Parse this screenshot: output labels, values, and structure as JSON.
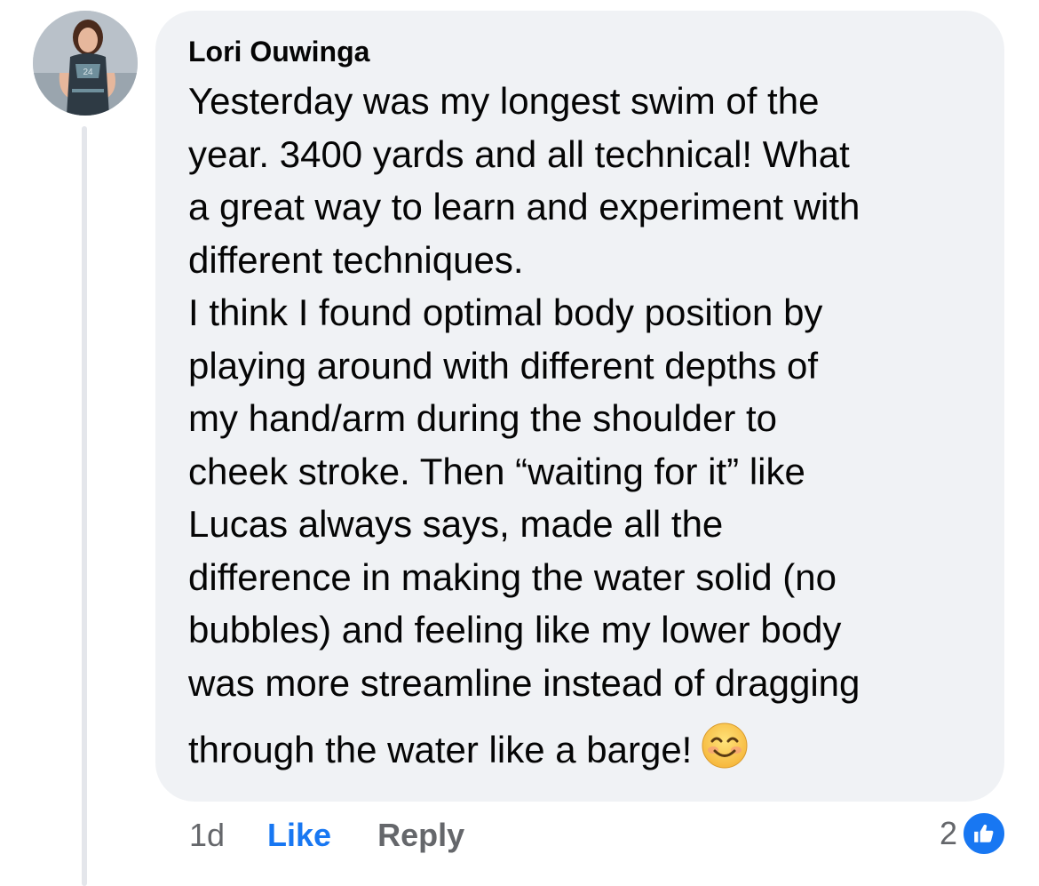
{
  "comment": {
    "author": "Lori Ouwinga",
    "text": "Yesterday was my longest swim of the\nyear.  3400 yards and all technical! What\na great way to learn and experiment with\ndifferent techniques.\nI think I found optimal body position by\nplaying around with different depths of\nmy hand/arm during the shoulder to\ncheek stroke.  Then “waiting for it” like\nLucas always says, made all the\ndifference in making the water solid (no\nbubbles) and feeling like my lower body\nwas more streamline instead of dragging",
    "last_line": "through the water like a barge!",
    "emoji": "smiling-face-icon"
  },
  "actions": {
    "time": "1d",
    "like_label": "Like",
    "reply_label": "Reply"
  },
  "reactions": {
    "count": "2",
    "icon": "thumbs-up-icon"
  },
  "colors": {
    "bubble": "#f0f2f5",
    "like_blue": "#1877f2",
    "muted": "#65676b",
    "text": "#050505"
  }
}
